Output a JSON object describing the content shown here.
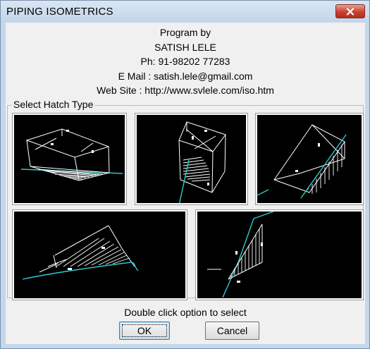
{
  "window": {
    "title": "PIPING ISOMETRICS",
    "close_icon": "close-x-icon"
  },
  "credits": {
    "line1": "Program by",
    "line2": "SATISH LELE",
    "line3": "Ph: 91-98202 77283",
    "line4": "E Mail : satish.lele@gmail.com",
    "line5": "Web Site : http://www.svlele.com/iso.htm"
  },
  "hatch_group": {
    "label": "Select Hatch Type",
    "options": [
      {
        "name": "hatch-option-1"
      },
      {
        "name": "hatch-option-2"
      },
      {
        "name": "hatch-option-3"
      },
      {
        "name": "hatch-option-4"
      },
      {
        "name": "hatch-option-5"
      }
    ]
  },
  "hint": "Double click option to select",
  "buttons": {
    "ok": "OK",
    "cancel": "Cancel"
  },
  "colors": {
    "title_bar": "#c4d7ec",
    "dialog_face": "#f0f0f0",
    "preview_background": "#000000",
    "pipe_line": "#2ec8d4",
    "close_button": "#c8412f"
  }
}
